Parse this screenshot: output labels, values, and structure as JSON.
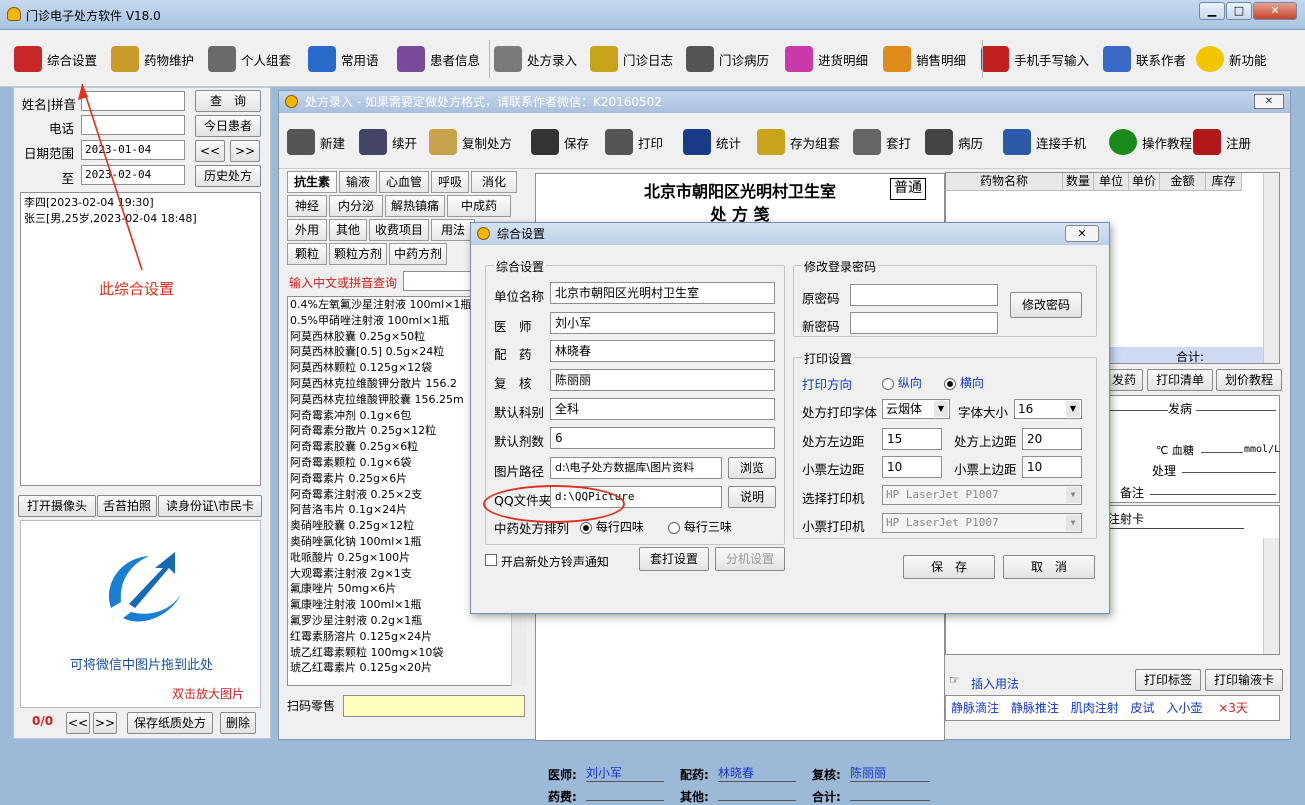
{
  "window": {
    "title": "门诊电子处方软件  V18.0"
  },
  "toolbar": {
    "items": [
      {
        "label": "综合设置",
        "icon": "gear-disk-icon",
        "color": "#c82828"
      },
      {
        "label": "药物维护",
        "icon": "books-icon",
        "color": "#c89b2a"
      },
      {
        "label": "个人组套",
        "icon": "notebook-icon",
        "color": "#6a6a6a"
      },
      {
        "label": "常用语",
        "icon": "chart-board-icon",
        "color": "#2a6ac8"
      },
      {
        "label": "患者信息",
        "icon": "people-icon",
        "color": "#7a4a9a"
      },
      {
        "label": "处方录入",
        "icon": "pen-paper-icon",
        "color": "#7a7a7a"
      },
      {
        "label": "门诊日志",
        "icon": "notepad-icon",
        "color": "#c8a41a"
      },
      {
        "label": "门诊病历",
        "icon": "document-icon",
        "color": "#555555"
      },
      {
        "label": "进货明细",
        "icon": "bar-chart-icon",
        "color": "#c83aa8"
      },
      {
        "label": "销售明细",
        "icon": "sales-chart-icon",
        "color": "#e08a1a"
      },
      {
        "label": "手机手写输入",
        "icon": "phone-tools-icon",
        "color": "#c02020"
      },
      {
        "label": "联系作者",
        "icon": "person-icon",
        "color": "#3a6ac8"
      },
      {
        "label": "新功能",
        "icon": "smiley-icon",
        "color": "#f2c500"
      }
    ]
  },
  "left": {
    "name_label": "姓名|拼音",
    "phone_label": "电话",
    "date_label": "日期范围",
    "to_label": "至",
    "date_from": "2023-01-04",
    "date_to": "2023-02-04",
    "query_btn": "查　询",
    "today_btn": "今日患者",
    "prev_btn": "<<",
    "next_btn": ">>",
    "history_btn": "历史处方",
    "patients": [
      "李四[2023-02-04 19:30]",
      "张三[男,25岁,2023-02-04 18:48]"
    ],
    "camera_btn": "打开摄像头",
    "tongue_btn": "舌苔拍照",
    "idcard_btn": "读身份证\\市民卡",
    "drop_hint": "可将微信中图片拖到此处",
    "zoom_hint": "双击放大图片",
    "counter": "0/0",
    "save_paper_btn": "保存纸质处方",
    "delete_btn": "删除"
  },
  "annotation": "此综合设置",
  "rxwin": {
    "title": "处方录入 - 如果需要定做处方格式，请联系作者微信：K20160502",
    "tools": [
      {
        "label": "新建",
        "icon": "new-icon"
      },
      {
        "label": "续开",
        "icon": "continue-icon"
      },
      {
        "label": "复制处方",
        "icon": "folder-icon"
      },
      {
        "label": "保存",
        "icon": "save-icon"
      },
      {
        "label": "打印",
        "icon": "printer-icon"
      },
      {
        "label": "统计",
        "icon": "stats-icon"
      },
      {
        "label": "存为组套",
        "icon": "notepad-icon"
      },
      {
        "label": "套打",
        "icon": "printer2-icon"
      },
      {
        "label": "病历",
        "icon": "record-icon"
      },
      {
        "label": "连接手机",
        "icon": "phone-icon"
      },
      {
        "label": "操作教程",
        "icon": "help-icon"
      },
      {
        "label": "注册",
        "icon": "register-icon"
      }
    ],
    "tabs": [
      [
        "抗生素",
        "输液",
        "心血管",
        "呼吸",
        "消化"
      ],
      [
        "神经",
        "内分泌",
        "解热镇痛",
        "中成药"
      ],
      [
        "外用",
        "其他",
        "收费项目",
        "用法"
      ],
      [
        "颗粒",
        "颗粒方剂",
        "中药方剂"
      ]
    ],
    "search_label": "输入中文或拼音查询",
    "drugs": [
      "0.4%左氧氟沙星注射液 100ml×1瓶",
      "0.5%甲硝唑注射液 100ml×1瓶",
      "阿莫西林胶囊 0.25g×50粒",
      "阿莫西林胶囊[0.5] 0.5g×24粒",
      "阿莫西林颗粒 0.125g×12袋",
      "阿莫西林克拉维酸钾分散片 156.2",
      "阿莫西林克拉维酸钾胶囊 156.25m",
      "阿奇霉素冲剂 0.1g×6包",
      "阿奇霉素分散片 0.25g×12粒",
      "阿奇霉素胶囊 0.25g×6粒",
      "阿奇霉素颗粒 0.1g×6袋",
      "阿奇霉素片 0.25g×6片",
      "阿奇霉素注射液 0.25×2支",
      "阿昔洛韦片 0.1g×24片",
      "奥硝唑胶囊 0.25g×12粒",
      "奥硝唑氯化钠 100ml×1瓶",
      "吡哌酸片 0.25g×100片",
      "大观霉素注射液 2g×1支",
      "氟康唑片 50mg×6片",
      "氟康唑注射液 100ml×1瓶",
      "氟罗沙星注射液 0.2g×1瓶",
      "红霉素肠溶片 0.125g×24片",
      "琥乙红霉素颗粒 100mg×10袋",
      "琥乙红霉素片 0.125g×20片"
    ],
    "scan_label": "扫码零售",
    "clinic": "北京市朝阳区光明村卫生室",
    "rx_title": "处 方 笺",
    "rx_type": "普通",
    "grid_cols": [
      "药物名称",
      "数量",
      "单位",
      "单价",
      "金额",
      "库存"
    ],
    "total_label": "合计:",
    "side_btns": [
      "发药",
      "打印清单",
      "划价教程"
    ],
    "info": {
      "onset": "发病",
      "temp": "℃ 血糖",
      "glucose_unit": "mmol/L",
      "treat": "处理",
      "note": "备注",
      "inject_card": "注射卡"
    },
    "bottom": {
      "doctor_label": "医师:",
      "doctor": "刘小军",
      "dispense_label": "配药:",
      "dispense": "林晓春",
      "review_label": "复核:",
      "review": "陈丽丽",
      "drugfee_label": "药费:",
      "other_label": "其他:",
      "sum_label": "合计:"
    },
    "usage_label": "插入用法",
    "print_label_btn": "打印标签",
    "print_infusion_btn": "打印输液卡",
    "usages": [
      "静脉滴注",
      "静脉推注",
      "肌肉注射",
      "皮试",
      "入小壶"
    ],
    "times": "×3天"
  },
  "dialog": {
    "title": "综合设置",
    "general": "综合设置",
    "unit_label": "单位名称",
    "unit": "北京市朝阳区光明村卫生室",
    "doctor_label": "医　师",
    "doctor": "刘小军",
    "dispense_label": "配　药",
    "dispense": "林晓春",
    "review_label": "复　核",
    "review": "陈丽丽",
    "dept_label": "默认科别",
    "dept": "全科",
    "doses_label": "默认剂数",
    "doses": "6",
    "imgpath_label": "图片路径",
    "imgpath": "d:\\电子处方数据库\\图片资料",
    "browse_btn": "浏览",
    "qq_label": "QQ文件夹",
    "qq": "d:\\QQPicture",
    "explain_btn": "说明",
    "herb_label": "中药处方排列",
    "four": "每行四味",
    "three": "每行三味",
    "sound_label": "开启新处方铃声通知",
    "print_setup_btn": "套打设置",
    "split_btn": "分机设置",
    "pwd_group": "修改登录密码",
    "old_pwd": "原密码",
    "new_pwd": "新密码",
    "change_pwd_btn": "修改密码",
    "print_group": "打印设置",
    "orient_label": "打印方向",
    "portrait": "纵向",
    "landscape": "横向",
    "font_label": "处方打印字体",
    "font": "云烟体",
    "size_label": "字体大小",
    "size": "16",
    "left_margin_label": "处方左边距",
    "left_margin": "15",
    "top_margin_label": "处方上边距",
    "top_margin": "20",
    "small_left_label": "小票左边距",
    "small_left": "10",
    "small_top_label": "小票上边距",
    "small_top": "10",
    "printer_label": "选择打印机",
    "printer": "HP LaserJet P1007",
    "small_printer_label": "小票打印机",
    "small_printer": "HP LaserJet P1007",
    "save_btn": "保　存",
    "cancel_btn": "取　消"
  }
}
